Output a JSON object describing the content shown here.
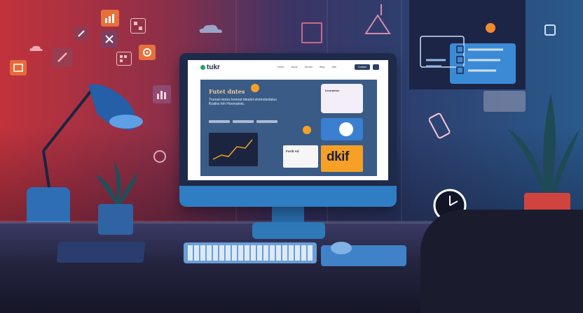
{
  "screen": {
    "logo": "tukr",
    "nav_links": [
      "Home",
      "About",
      "Service",
      "Blog",
      "Sale"
    ],
    "nav_button": "Contact",
    "hero_title": "Futet dntes",
    "hero_text": "Trureal rienes lorenat tdeatet elotmotedatus flcatles feh Hooreatnts.",
    "card_a_title": "Incoranion",
    "card_c_title": "Fordt Ad",
    "card_d_text": "dkif"
  },
  "colors": {
    "wall_left": "#c2333c",
    "wall_right": "#2a5a8c",
    "accent_orange": "#f6a126",
    "accent_blue": "#3b7fd1"
  },
  "icons": [
    "chart-icon",
    "pencil-icon",
    "close-x-icon",
    "grid-icon",
    "cloud-icon",
    "calculator-icon",
    "gear-icon",
    "image-icon",
    "location-icon",
    "phone-icon",
    "clock-icon",
    "coffee-icon",
    "hanger-icon",
    "frame-icon",
    "checklist-icon"
  ]
}
